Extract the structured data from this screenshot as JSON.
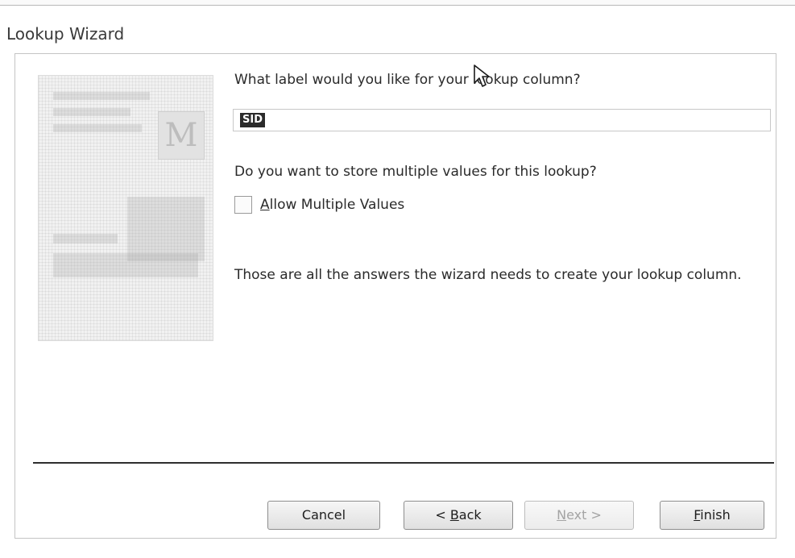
{
  "window": {
    "title": "Lookup Wizard"
  },
  "main": {
    "label_question": "What label would you like for your lookup column?",
    "label_input_value": "SID",
    "multi_question": "Do you want to store multiple values for this lookup?",
    "allow_multiple": {
      "mnemonic": "A",
      "rest": "llow Multiple Values",
      "checked": false
    },
    "info_text": "Those are all the answers the wizard needs to create your lookup column."
  },
  "buttons": {
    "cancel": "Cancel",
    "back_prefix": "< ",
    "back_mnemonic": "B",
    "back_rest": "ack",
    "next_mnemonic": "N",
    "next_rest": "ext >",
    "finish_mnemonic": "F",
    "finish_rest": "inish"
  },
  "icons": {
    "wizard_graphic": "wizard-illustration",
    "cursor": "mouse-pointer-icon"
  },
  "colors": {
    "selection_bg": "#2b2b2b",
    "divider": "#2e2e2e"
  }
}
